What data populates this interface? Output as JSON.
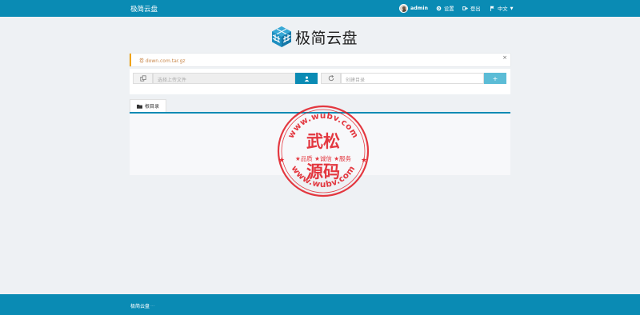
{
  "header": {
    "brand": "极简云盘",
    "user": "admin",
    "settings_label": "设置",
    "logout_label": "登出",
    "language_label": "中文"
  },
  "logo": {
    "text": "极简云盘"
  },
  "alert": {
    "text": "卷 down.com.tar.gz",
    "close_label": "×"
  },
  "upload": {
    "file_placeholder": "选择上传文件",
    "upload_icon": "user-upload-icon"
  },
  "folder": {
    "name_placeholder": "创建目录",
    "add_label": "+"
  },
  "tabs": [
    {
      "label": "根目录"
    }
  ],
  "stamp": {
    "top_arc": "www.wubv.com",
    "main_top": "武松",
    "middle": "★品质 ★诚信 ★服务",
    "main_bottom": "源码",
    "bottom_arc": "www.wubv.com"
  },
  "footer": {
    "brand": "极简云盘",
    "suffix": "···"
  },
  "colors": {
    "primary": "#0a8bb4",
    "alert": "#f0a30a",
    "stamp": "#e0161f",
    "add_button": "#5bbcd6"
  }
}
